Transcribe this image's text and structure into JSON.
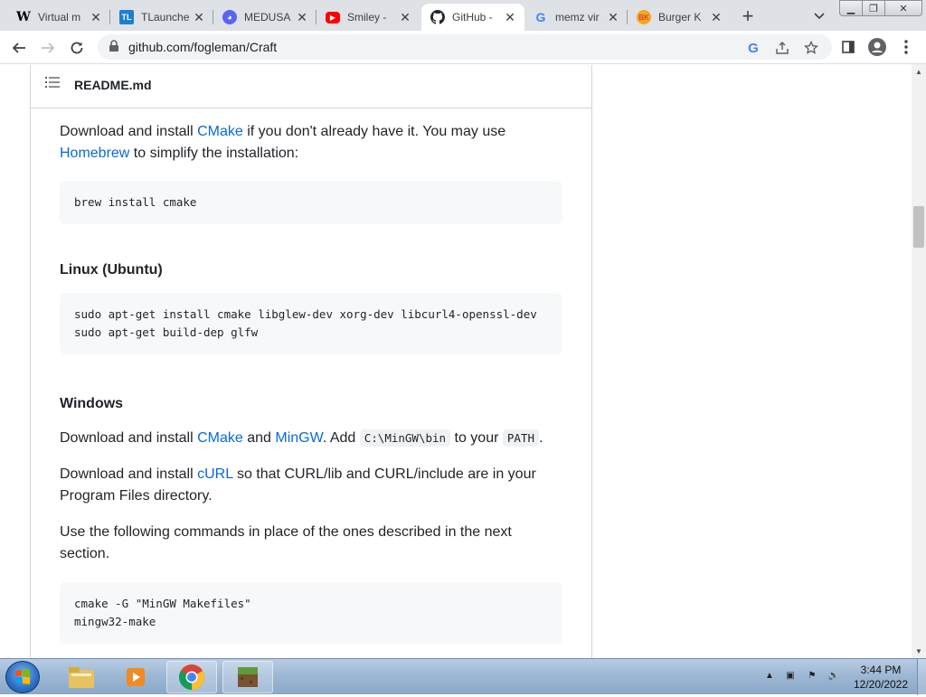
{
  "browser": {
    "tabs": [
      {
        "title": "Virtual m",
        "favicon": "W",
        "favicon_color": "#000000",
        "favicon_bg": "#ffffff"
      },
      {
        "title": "TLaunche",
        "favicon": "TL",
        "favicon_color": "#ffffff",
        "favicon_bg": "#1e7fd1"
      },
      {
        "title": "MEDUSA",
        "favicon": "M",
        "favicon_color": "#ffffff",
        "favicon_bg": "#5865f2"
      },
      {
        "title": "Smiley - ",
        "favicon": "▶",
        "favicon_color": "#ffffff",
        "favicon_bg": "#ff0000"
      },
      {
        "title": "GitHub - ",
        "favicon": "github-icon",
        "active": true
      },
      {
        "title": "memz vir",
        "favicon": "G",
        "favicon_color": "#4285f4",
        "favicon_bg": "#ffffff"
      },
      {
        "title": "Burger K",
        "favicon": "BK",
        "favicon_color": "#ffffff",
        "favicon_bg": "#d9482b"
      }
    ],
    "url": "github.com/fogleman/Craft"
  },
  "readme": {
    "file_name": "README.md",
    "mac_install": {
      "before_cmake": "Download and install ",
      "cmake_link": "CMake",
      "middle": " if you don't already have it. You may use ",
      "homebrew_link": "Homebrew",
      "after": " to simplify the installation:",
      "code": "brew install cmake"
    },
    "linux": {
      "heading": "Linux (Ubuntu)",
      "code": "sudo apt-get install cmake libglew-dev xorg-dev libcurl4-openssl-dev\nsudo apt-get build-dep glfw"
    },
    "windows": {
      "heading": "Windows",
      "p1_before": "Download and install ",
      "p1_cmake": "CMake",
      "p1_and": " and ",
      "p1_mingw": "MinGW",
      "p1_add": ". Add ",
      "p1_code1": "C:\\MinGW\\bin",
      "p1_to": " to your ",
      "p1_code2": "PATH",
      "p1_end": ".",
      "p2_before": "Download and install ",
      "p2_curl": "cURL",
      "p2_after": " so that CURL/lib and CURL/include are in your Program Files directory.",
      "p3": "Use the following commands in place of the ones described in the next section.",
      "code": "cmake -G \"MinGW Makefiles\"\nmingw32-make"
    }
  },
  "taskbar": {
    "time": "3:44 PM",
    "date": "12/20/2022"
  }
}
